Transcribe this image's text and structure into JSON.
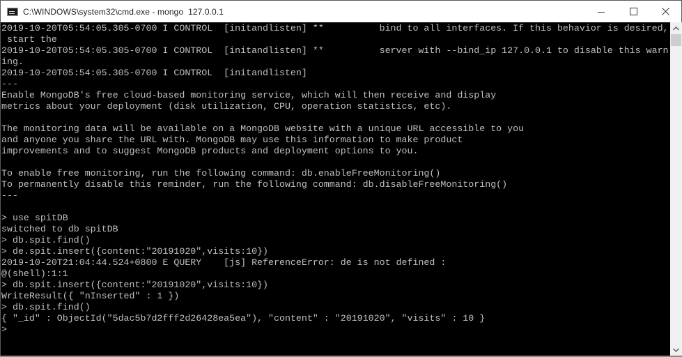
{
  "window": {
    "title": "C:\\WINDOWS\\system32\\cmd.exe - mongo  127.0.0.1",
    "icon": "cmd-icon",
    "controls": {
      "minimize": "minimize-icon",
      "maximize": "maximize-icon",
      "close": "close-icon"
    }
  },
  "console": {
    "lines": [
      "2019-10-20T05:54:05.305-0700 I CONTROL  [initandlisten] **          bind to all interfaces. If this behavior is desired,",
      " start the",
      "2019-10-20T05:54:05.305-0700 I CONTROL  [initandlisten] **          server with --bind_ip 127.0.0.1 to disable this warn",
      "ing.",
      "2019-10-20T05:54:05.305-0700 I CONTROL  [initandlisten]",
      "---",
      "Enable MongoDB's free cloud-based monitoring service, which will then receive and display",
      "metrics about your deployment (disk utilization, CPU, operation statistics, etc).",
      "",
      "The monitoring data will be available on a MongoDB website with a unique URL accessible to you",
      "and anyone you share the URL with. MongoDB may use this information to make product",
      "improvements and to suggest MongoDB products and deployment options to you.",
      "",
      "To enable free monitoring, run the following command: db.enableFreeMonitoring()",
      "To permanently disable this reminder, run the following command: db.disableFreeMonitoring()",
      "---",
      "",
      "> use spitDB",
      "switched to db spitDB",
      "> db.spit.find()",
      "> de.spit.insert({content:\"20191020\",visits:10})",
      "2019-10-20T21:04:44.524+0800 E QUERY    [js] ReferenceError: de is not defined :",
      "@(shell):1:1",
      "> db.spit.insert({content:\"20191020\",visits:10})",
      "WriteResult({ \"nInserted\" : 1 })",
      "> db.spit.find()",
      "{ \"_id\" : ObjectId(\"5dac5b7d2fff2d26428ea5ea\"), \"content\" : \"20191020\", \"visits\" : 10 }",
      ">"
    ]
  },
  "scrollbar": {
    "up": "chevron-up-icon",
    "down": "chevron-down-icon",
    "position": 0
  }
}
